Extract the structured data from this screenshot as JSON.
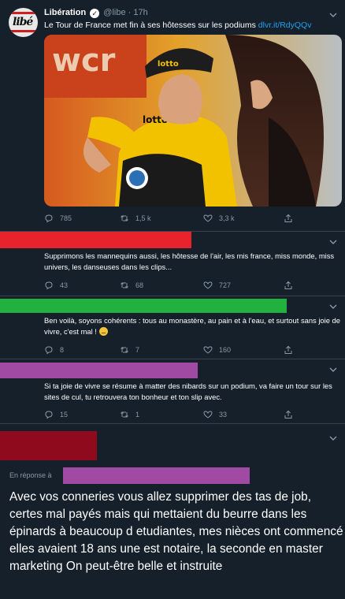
{
  "colors": {
    "background": "#15202b",
    "muted": "#8899a6",
    "link": "#1da1f2",
    "divider": "#38444d"
  },
  "main_tweet": {
    "avatar_text": "libé",
    "author_name": "Libération",
    "verified_icon": "verified-badge-icon",
    "handle": "@libe",
    "separator": "·",
    "time": "17h",
    "text": "Le Tour de France met fin à ses hôtesses sur les podiums ",
    "link": "dlvr.it/RdyQQv",
    "image_shirt_text": "lotto",
    "actions": {
      "replies": "785",
      "retweets": "1,5 k",
      "likes": "3,3 k"
    }
  },
  "replies": [
    {
      "redaction_color": "#e8232b",
      "text": "Supprimons les mannequins aussi, les hôtesse de l'air, les mis france, miss monde, miss univers, les danseuses dans les clips...",
      "actions": {
        "replies": "43",
        "retweets": "68",
        "likes": "727"
      }
    },
    {
      "redaction_color": "#22b03e",
      "text": "Ben voilà, soyons cohérents : tous au monastère, au pain et à l'eau, et surtout sans joie de vivre, c'est mal !",
      "emoji": "slightly-frowning-face-emoji",
      "actions": {
        "replies": "8",
        "retweets": "7",
        "likes": "160"
      }
    },
    {
      "redaction_color": "#a04aa4",
      "text": "Si ta joie de vivre se résume à matter des nibards sur un podium, va faire un tour sur les sites de cul, tu retrouvera ton bonheur et ton slip avec.",
      "actions": {
        "replies": "15",
        "retweets": "1",
        "likes": "33"
      }
    },
    {
      "redaction_color": "#8e0a1c"
    }
  ],
  "in_reply": {
    "label": "En réponse à",
    "redaction_color": "#a04aa4"
  },
  "focused_text": "Avec vos conneries vous allez supprimer des tas de job, certes mal payés  mais qui mettaient du beurre dans les épinards à beaucoup d etudiantes, mes nièces ont commencé elles avaient 18 ans  une est notaire, la seconde en master marketing On peut-être belle et instruite"
}
